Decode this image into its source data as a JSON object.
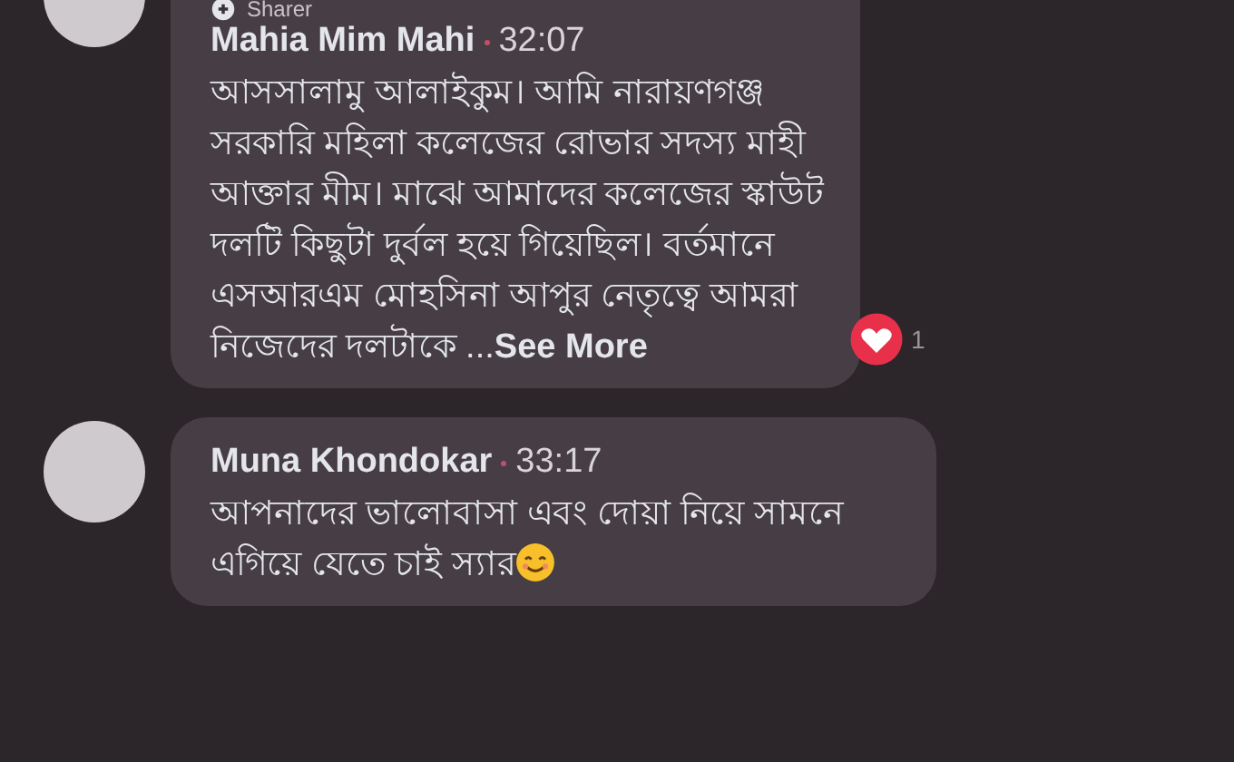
{
  "comments": [
    {
      "badge": "Sharer",
      "author": "Mahia Mim Mahi",
      "time": "32:07",
      "text": "আসসালামু আলাইকুম।  আমি নারায়ণগঞ্জ সরকারি মহিলা কলেজের রোভার সদস্য মাহী আক্তার মীম। মাঝে আমাদের কলেজের স্কাউট দলটি কিছুটা দুর্বল হয়ে গিয়েছিল।  বর্তমানে এসআরএম মোহসিনা আপুর নেতৃত্বে আমরা নিজেদের দলটাকে ...",
      "see_more": "See More",
      "emoji": false,
      "reaction_count": "1"
    },
    {
      "author": "Muna Khondokar",
      "time": "33:17",
      "text": "আপনাদের ভালোবাসা এবং দোয়া নিয়ে সামনে এগিয়ে যেতে চাই স্যার",
      "emoji": true
    }
  ]
}
